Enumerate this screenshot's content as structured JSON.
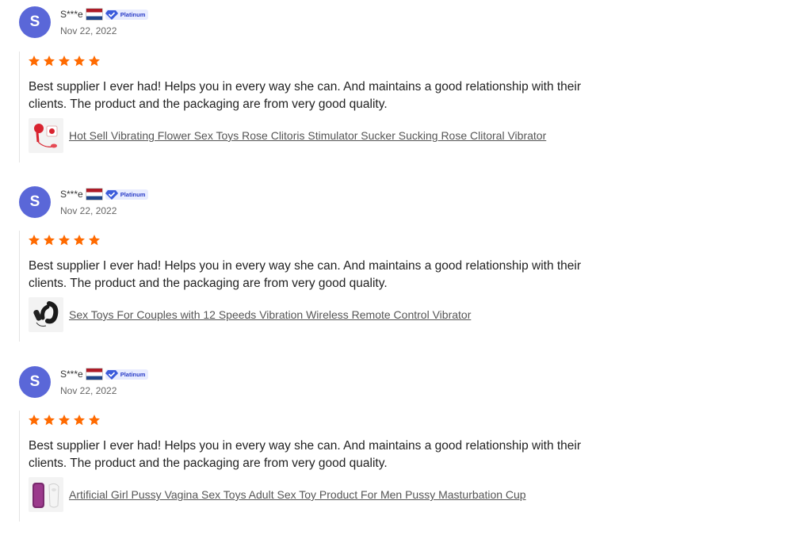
{
  "colors": {
    "avatar": "#5a67d8",
    "star": "#ff6a00",
    "badge_bg": "#e8ecff",
    "badge_text": "#2a3cc7",
    "link": "#555555"
  },
  "reviews": [
    {
      "avatar_letter": "S",
      "user": "S***e",
      "country_flag": "netherlands-flag",
      "badge": "Platinum",
      "date": "Nov 22, 2022",
      "rating": 5,
      "text": "Best supplier I ever had! Helps you in every way she can. And maintains a good relationship with their clients. The product and the packaging are from very good quality.",
      "product_title": "Hot Sell Vibrating Flower Sex Toys Rose Clitoris Stimulator Sucker Sucking Rose Clitoral Vibrator",
      "product_thumb": "rose-vibrator-thumb"
    },
    {
      "avatar_letter": "S",
      "user": "S***e",
      "country_flag": "netherlands-flag",
      "badge": "Platinum",
      "date": "Nov 22, 2022",
      "rating": 5,
      "text": "Best supplier I ever had! Helps you in every way she can. And maintains a good relationship with their clients. The product and the packaging are from very good quality.",
      "product_title": "Sex Toys For Couples with 12 Speeds Vibration Wireless Remote Control Vibrator",
      "product_thumb": "couples-vibrator-thumb"
    },
    {
      "avatar_letter": "S",
      "user": "S***e",
      "country_flag": "netherlands-flag",
      "badge": "Platinum",
      "date": "Nov 22, 2022",
      "rating": 5,
      "text": "Best supplier I ever had! Helps you in every way she can. And maintains a good relationship with their clients. The product and the packaging are from very good quality.",
      "product_title": "Artificial Girl Pussy Vagina Sex Toys Adult Sex Toy Product For Men Pussy Masturbation Cup",
      "product_thumb": "masturbation-cup-thumb"
    }
  ]
}
